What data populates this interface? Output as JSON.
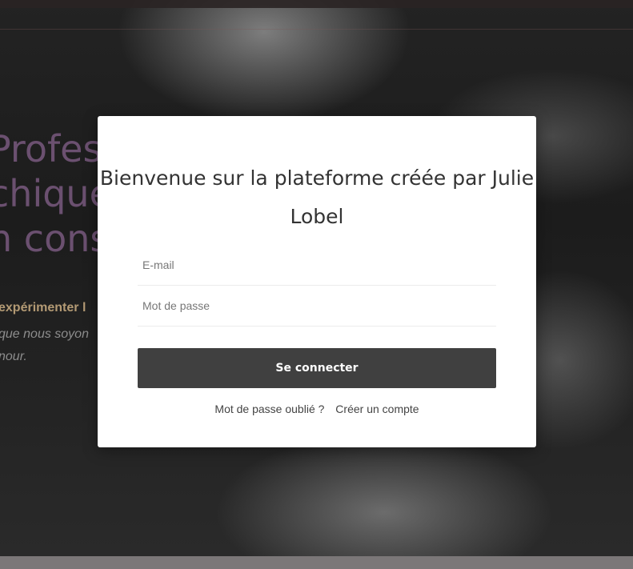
{
  "background": {
    "hero_title_lines": [
      "Profes",
      "chique",
      "n cons"
    ],
    "hero_subtitle": "expérimenter l",
    "hero_text_lines": [
      "que nous soyon",
      "nour."
    ]
  },
  "login_modal": {
    "title": "Bienvenue sur la plateforme créée par Julie Lobel",
    "email_placeholder": "E-mail",
    "password_placeholder": "Mot de passe",
    "submit_label": "Se connecter",
    "forgot_password_link": "Mot de passe oublié ?",
    "create_account_link": "Créer un compte"
  },
  "colors": {
    "accent_purple": "#6b5070",
    "accent_gold": "#b39a74",
    "button_bg": "#404040"
  }
}
